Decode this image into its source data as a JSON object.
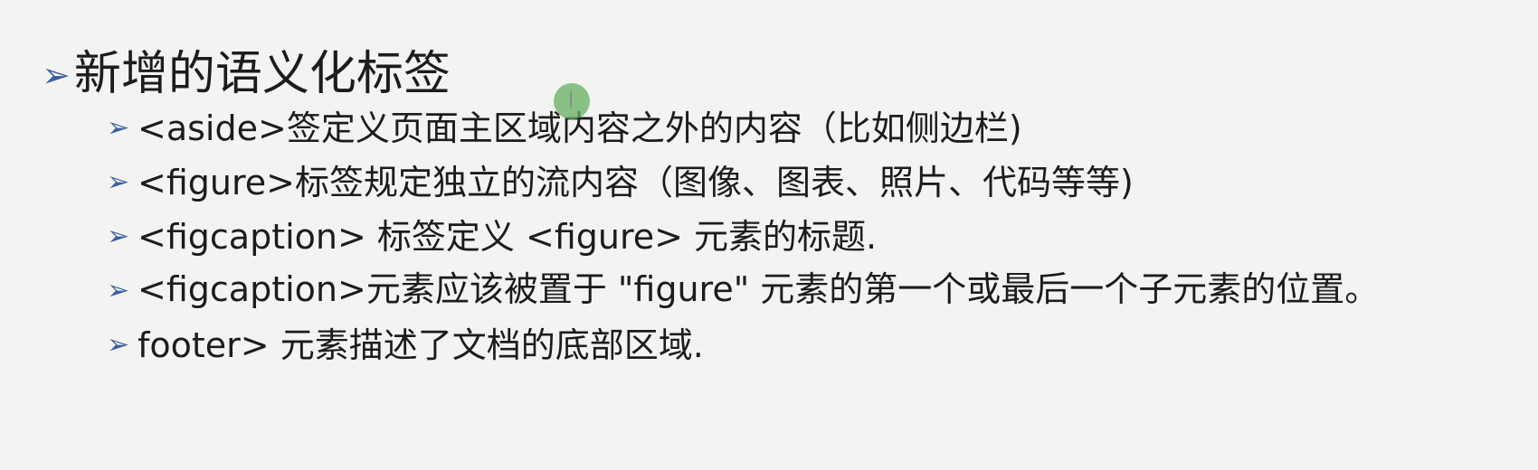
{
  "slide": {
    "heading": "新增的语义化标签",
    "bullet_glyph": "➢",
    "bullet_color": "#3a5f9e",
    "items": [
      {
        "text": "<aside>签定义页面主区域内容之外的内容（比如侧边栏)"
      },
      {
        "text": "<figure>标签规定独立的流内容（图像、图表、照片、代码等等)"
      },
      {
        "text": "<figcaption> 标签定义 <figure> 元素的标题."
      },
      {
        "text": "<figcaption>元素应该被置于 \"figure\" 元素的第一个或最后一个子元素的位置。"
      },
      {
        "text": "footer> 元素描述了文档的底部区域."
      }
    ]
  },
  "cursor": {
    "icon": "text-cursor-icon",
    "highlight_color": "#66b060"
  }
}
